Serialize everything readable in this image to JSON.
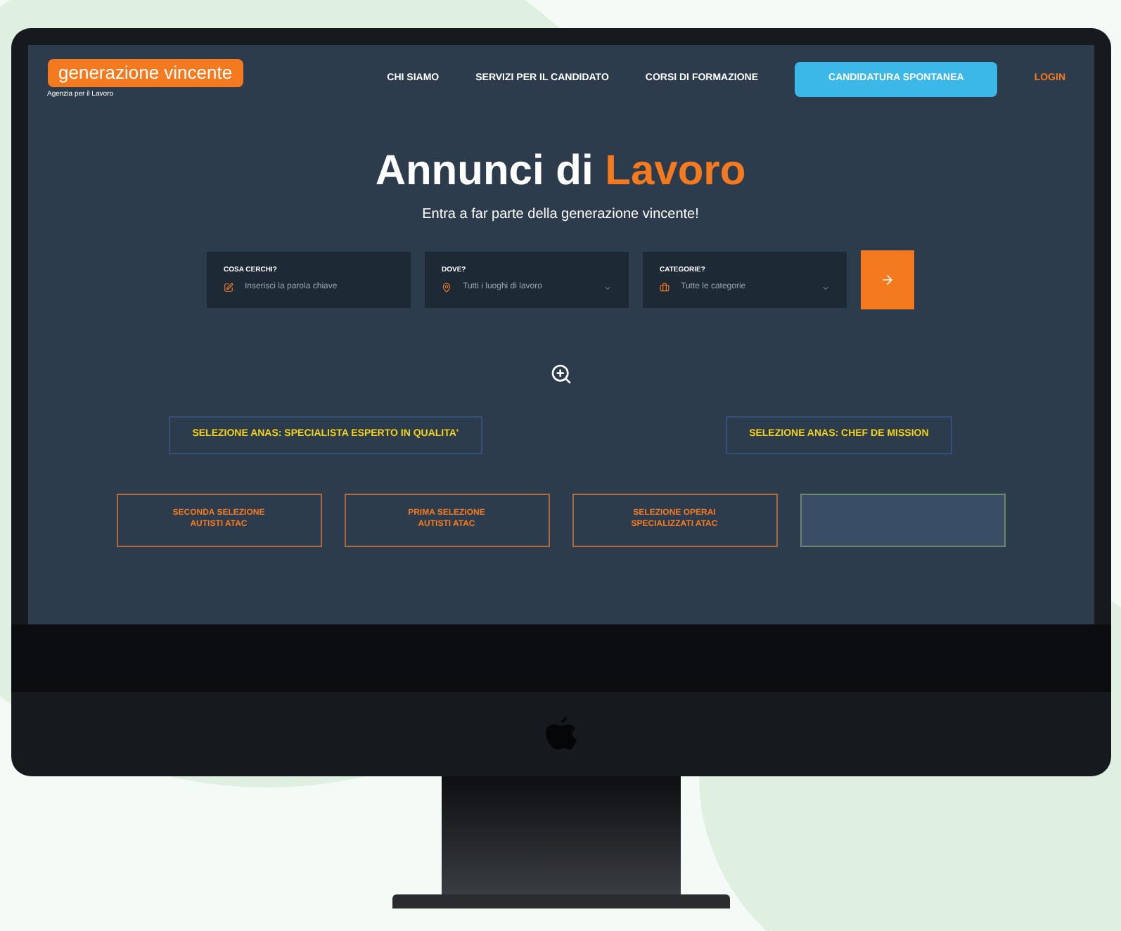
{
  "logo": {
    "name": "generazione vincente",
    "tagline": "Agenzia per il Lavoro"
  },
  "nav": [
    {
      "label": "CHI SIAMO",
      "kind": "link"
    },
    {
      "label": "SERVIZI PER IL CANDIDATO",
      "kind": "link"
    },
    {
      "label": "CORSI DI FORMAZIONE",
      "kind": "link"
    },
    {
      "label": "CANDIDATURA SPONTANEA",
      "kind": "button"
    },
    {
      "label": "LOGIN",
      "kind": "accent"
    }
  ],
  "hero": {
    "title": "Annunci di **Lavoro**",
    "subtitle": "Entra a far parte della generazione vincente!"
  },
  "search": [
    {
      "label": "COSA CERCHI?",
      "placeholder": "Inserisci la parola chiave",
      "kind": "text"
    },
    {
      "label": "DOVE?",
      "placeholder": "Tutti i luoghi di lavoro",
      "kind": "select"
    },
    {
      "label": "CATEGORIE?",
      "placeholder": "Tutte le categorie",
      "kind": "select"
    }
  ],
  "banners": [
    "SELEZIONE ANAS: SPECIALISTA ESPERTO IN QUALITA'",
    "SELEZIONE ANAS: CHEF DE MISSION"
  ],
  "cards": [
    {
      "lines": [
        "SECONDA SELEZIONE",
        "AUTISTI ATAC"
      ]
    },
    {
      "lines": [
        "PRIMA SELEZIONE",
        "AUTISTI ATAC"
      ]
    },
    {
      "lines": [
        "SELEZIONE OPERAI",
        "SPECIALIZZATI ATAC"
      ]
    }
  ]
}
